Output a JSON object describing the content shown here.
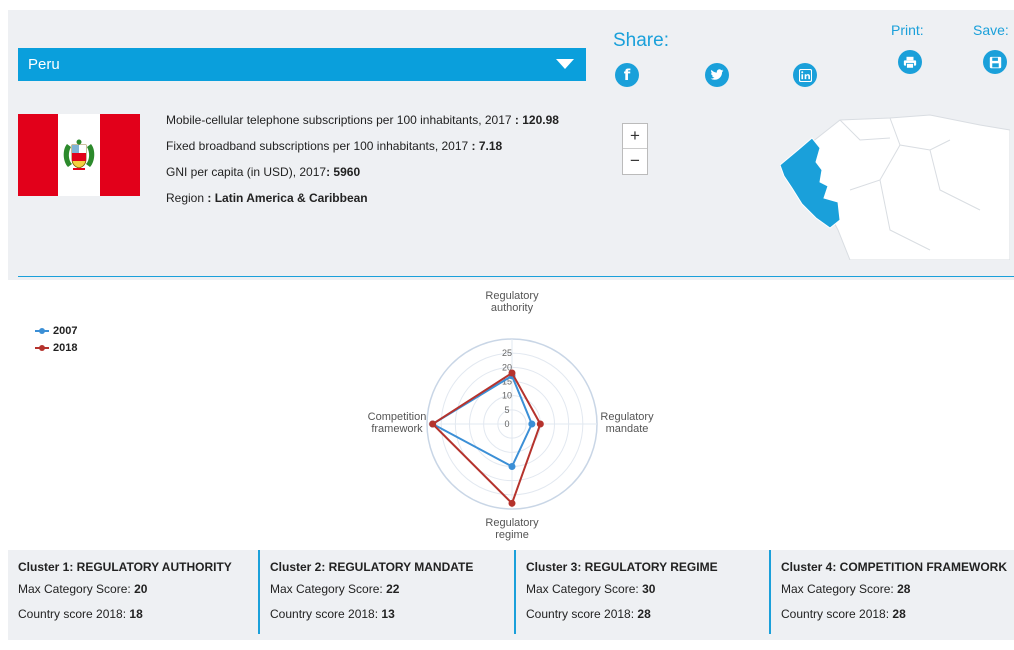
{
  "country": {
    "selected": "Peru"
  },
  "share": {
    "label": "Share:",
    "print_label": "Print:",
    "save_label": "Save:"
  },
  "stats": {
    "mobile_label": "Mobile-cellular telephone subscriptions per 100 inhabitants, 2017",
    "mobile_value": "120.98",
    "broadband_label": "Fixed broadband subscriptions per 100 inhabitants, 2017",
    "broadband_value": "7.18",
    "gni_label": "GNI per capita (in USD), 2017",
    "gni_value": "5960",
    "region_label": "Region",
    "region_value": "Latin America & Caribbean"
  },
  "map_controls": {
    "zoom_in": "+",
    "zoom_out": "−"
  },
  "chart_data": {
    "type": "radar",
    "axes": [
      [
        "Regulatory",
        "authority"
      ],
      [
        "Regulatory",
        "mandate"
      ],
      [
        "Regulatory",
        "regime"
      ],
      [
        "Competition",
        "framework"
      ]
    ],
    "radial_ticks": [
      "0",
      "5",
      "10",
      "15",
      "20",
      "25"
    ],
    "rmax": 30,
    "series": [
      {
        "name": "2007",
        "color": "#3b8fd6",
        "values": [
          17,
          7,
          15,
          28
        ]
      },
      {
        "name": "2018",
        "color": "#b5332d",
        "values": [
          18,
          10,
          28,
          28
        ]
      }
    ],
    "legend_position": "top-left"
  },
  "clusters": [
    {
      "title": "Cluster 1: REGULATORY AUTHORITY",
      "max_label": "Max Category Score:",
      "max_value": "20",
      "score_label": "Country score 2018:",
      "score_value": "18"
    },
    {
      "title": "Cluster 2: REGULATORY MANDATE",
      "max_label": "Max Category Score:",
      "max_value": "22",
      "score_label": "Country score 2018:",
      "score_value": "13"
    },
    {
      "title": "Cluster 3: REGULATORY REGIME",
      "max_label": "Max Category Score:",
      "max_value": "30",
      "score_label": "Country score 2018:",
      "score_value": "28"
    },
    {
      "title": "Cluster 4: COMPETITION FRAMEWORK",
      "max_label": "Max Category Score:",
      "max_value": "28",
      "score_label": "Country score 2018:",
      "score_value": "28"
    }
  ]
}
